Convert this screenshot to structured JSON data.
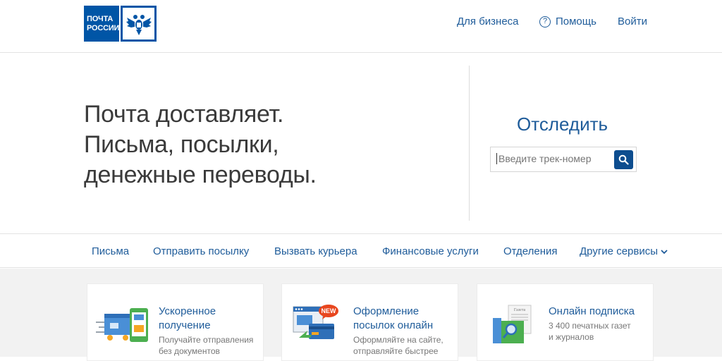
{
  "header": {
    "logo_line1": "ПОЧТА",
    "logo_line2": "РОССИИ",
    "nav": {
      "business": "Для бизнеса",
      "help": "Помощь",
      "login": "Войти"
    }
  },
  "hero": {
    "line1": "Почта доставляет.",
    "line2": "Письма, посылки,",
    "line3": "денежные переводы."
  },
  "track": {
    "title": "Отследить",
    "placeholder": "Введите трек-номер"
  },
  "navbar": {
    "items": [
      "Письма",
      "Отправить посылку",
      "Вызвать курьера",
      "Финансовые услуги",
      "Отделения",
      "Другие сервисы"
    ]
  },
  "cards": [
    {
      "title_line1": "Ускоренное",
      "title_line2": "получение",
      "desc_line1": "Получайте отправления",
      "desc_line2": "без документов"
    },
    {
      "title_line1": "Оформление",
      "title_line2": "посылок онлайн",
      "desc_line1": "Оформляйте на сайте,",
      "desc_line2": "отправляйте быстрее",
      "badge": "NEW"
    },
    {
      "title_line1": "Онлайн подписка",
      "title_line2": "",
      "desc_line1": "3 400 печатных газет",
      "desc_line2": "и журналов",
      "newspaper_label": "Газета"
    }
  ],
  "colors": {
    "brand": "#0055a6",
    "link": "#1f5c9a",
    "badge": "#e8461e"
  }
}
